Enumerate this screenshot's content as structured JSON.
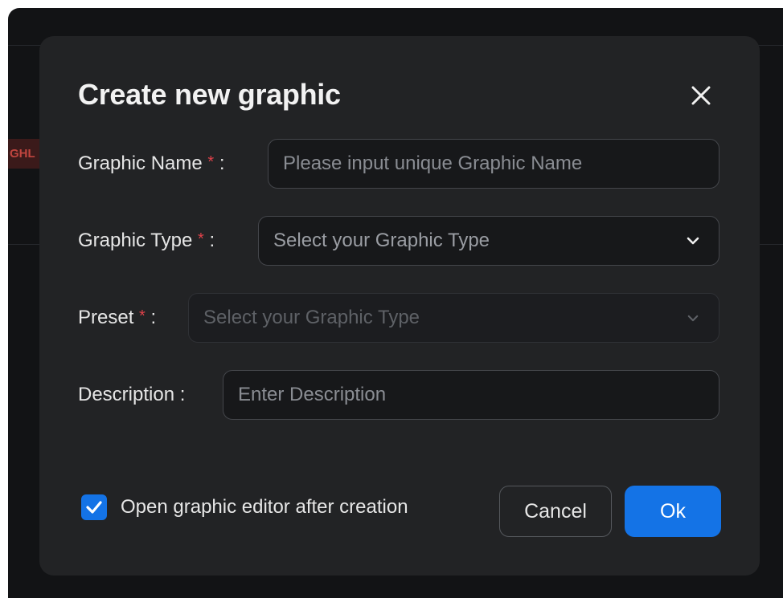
{
  "background": {
    "tag_text": "GHL"
  },
  "dialog": {
    "title": "Create new graphic",
    "fields": {
      "name": {
        "label": "Graphic Name",
        "placeholder": "Please input unique Graphic Name",
        "value": ""
      },
      "type": {
        "label": "Graphic Type",
        "placeholder": "Select your Graphic Type"
      },
      "preset": {
        "label": "Preset",
        "placeholder": "Select your Graphic Type",
        "disabled": true
      },
      "description": {
        "label": "Description",
        "placeholder": "Enter Description",
        "value": ""
      }
    },
    "required_mark": "*",
    "label_suffix": ":",
    "checkbox": {
      "label": "Open graphic editor after creation",
      "checked": true
    },
    "buttons": {
      "cancel": "Cancel",
      "ok": "Ok"
    }
  },
  "colors": {
    "accent": "#1473e6",
    "required": "#e0424a",
    "dialog_bg": "#222325",
    "page_bg": "#121315"
  },
  "icons": {
    "close": "close-icon",
    "dropdown": "chevron-down-icon",
    "check": "check-icon"
  }
}
